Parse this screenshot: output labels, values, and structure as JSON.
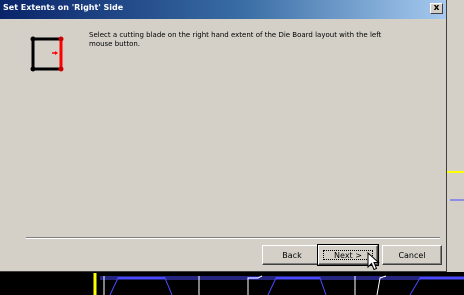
{
  "dialog": {
    "title": "Set Extents on 'Right' Side",
    "close_label": "x",
    "instruction": "Select a cutting blade on the right hand extent of the Die Board layout with the left mouse button.",
    "buttons": {
      "back": "Back",
      "next": "Next >",
      "cancel": "Cancel"
    }
  },
  "icons": {
    "instruction": "right-side-extent-icon",
    "close": "close-icon",
    "cursor": "mouse-pointer-icon"
  },
  "colors": {
    "title_start": "#0a246a",
    "title_end": "#a6caf0",
    "dialog_bg": "#d4d0c8",
    "cad_background": "#000000",
    "cad_lines": "#4a4aff",
    "cad_highlight": "#ffff00",
    "side_highlight": "#ff0000"
  }
}
